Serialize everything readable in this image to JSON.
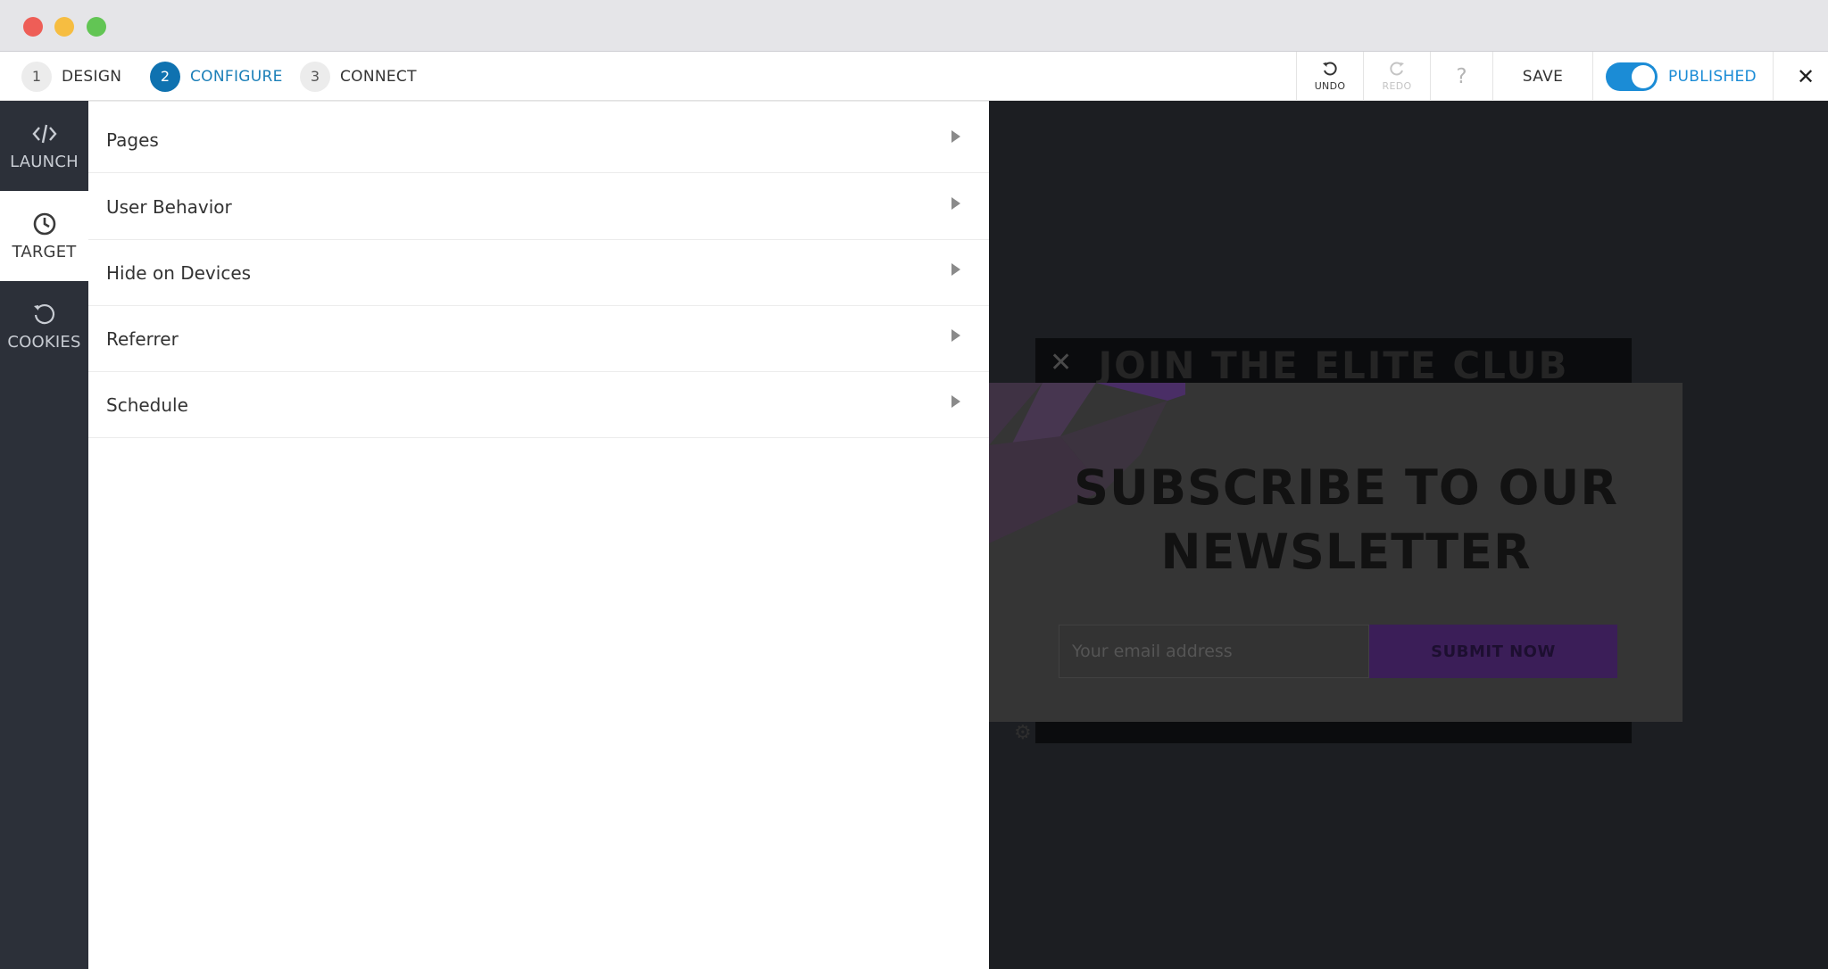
{
  "window": {
    "traffic_lights": [
      "close",
      "minimize",
      "zoom"
    ]
  },
  "steps": [
    {
      "num": "1",
      "label": "DESIGN",
      "active": false
    },
    {
      "num": "2",
      "label": "CONFIGURE",
      "active": true
    },
    {
      "num": "3",
      "label": "CONNECT",
      "active": false
    }
  ],
  "toolbar": {
    "undo": {
      "icon": "undo-icon",
      "label": "UNDO"
    },
    "redo": {
      "icon": "redo-icon",
      "label": "REDO"
    },
    "help": "?",
    "save": "SAVE",
    "published": "PUBLISHED",
    "published_on": true,
    "close": "✕"
  },
  "sidebar": {
    "items": [
      {
        "label": "LAUNCH",
        "icon": "code-icon"
      },
      {
        "label": "TARGET",
        "icon": "clock-icon"
      },
      {
        "label": "COOKIES",
        "icon": "history-icon"
      }
    ]
  },
  "panel": {
    "rows": [
      {
        "label": "Pages"
      },
      {
        "label": "User Behavior"
      },
      {
        "label": "Hide on Devices"
      },
      {
        "label": "Referrer"
      },
      {
        "label": "Schedule"
      }
    ]
  },
  "preview": {
    "back_title": "JOIN THE ELITE CLUB",
    "back_close": "✕",
    "headline_line1": "SUBSCRIBE TO OUR",
    "headline_line2": "NEWSLETTER",
    "email_placeholder": "Your email address",
    "submit_label": "SUBMIT NOW",
    "settings_icon": "gear-icon"
  },
  "colors": {
    "accent": "#1b8cd6",
    "step_active": "#0f72b0",
    "sidebar_bg": "#2c3039",
    "preview_bg": "#1c1e22",
    "submit_bg": "#3b1e58"
  }
}
